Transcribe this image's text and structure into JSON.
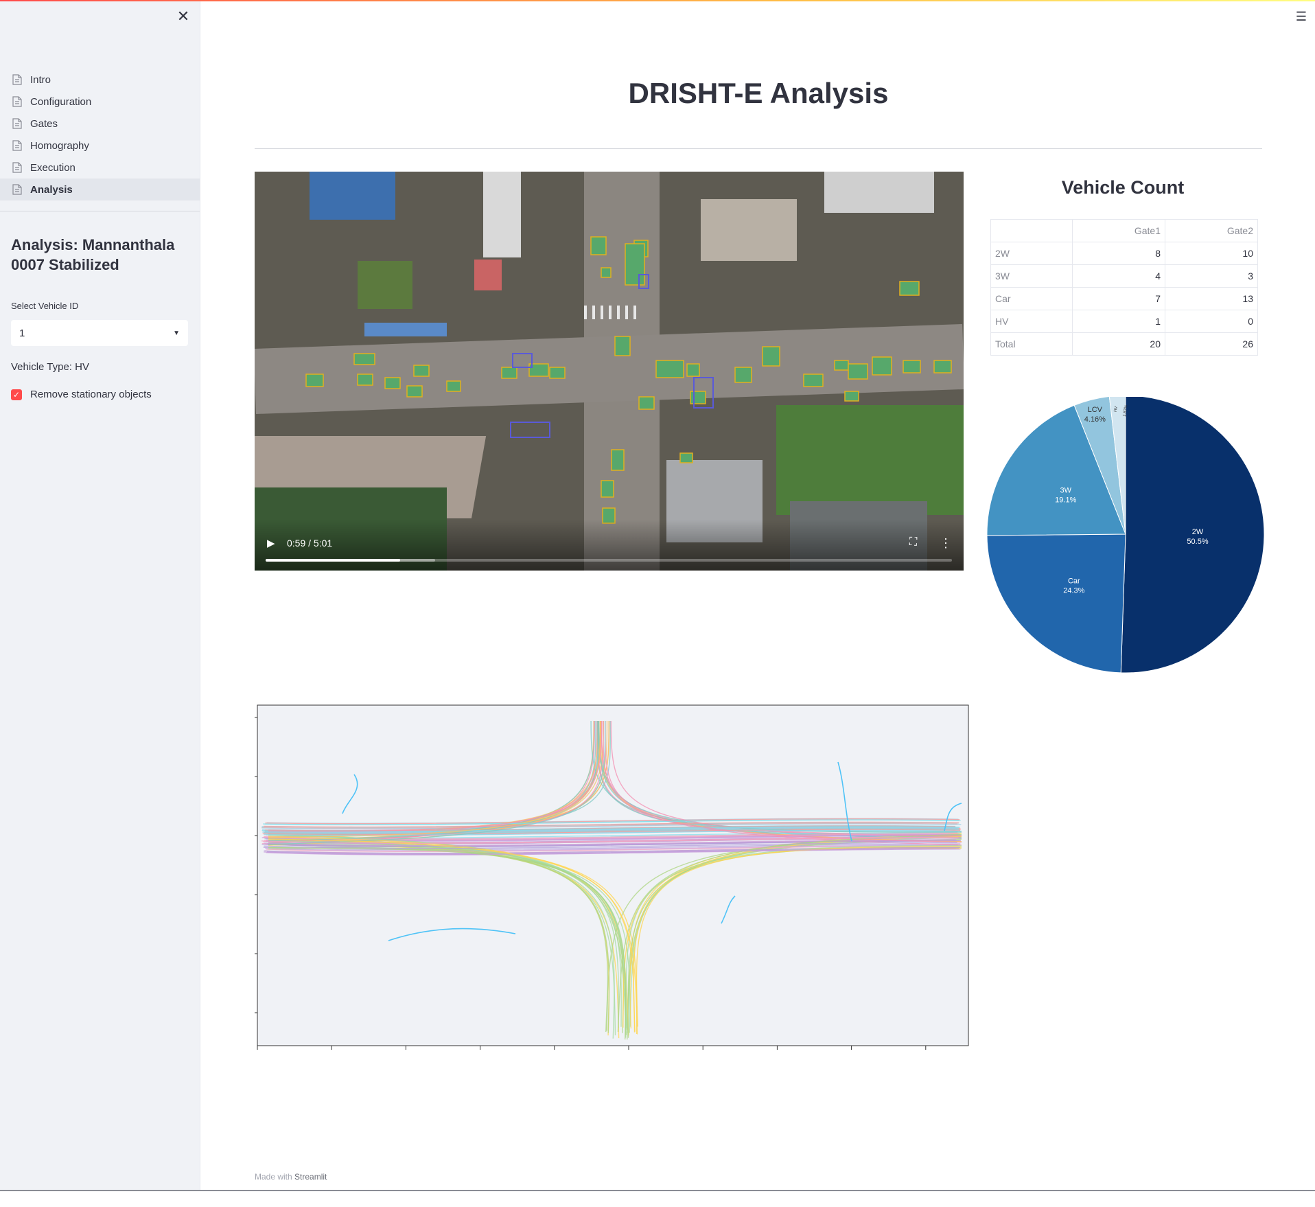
{
  "sidebar": {
    "nav_items": [
      {
        "label": "Intro"
      },
      {
        "label": "Configuration"
      },
      {
        "label": "Gates"
      },
      {
        "label": "Homography"
      },
      {
        "label": "Execution"
      },
      {
        "label": "Analysis"
      }
    ],
    "active_item": "Analysis",
    "analysis_title": "Analysis: Mannanthala 0007 Stabilized",
    "select_label": "Select Vehicle ID",
    "select_value": "1",
    "vehicle_type": "Vehicle Type: HV",
    "checkbox_label": "Remove stationary objects",
    "checkbox_checked": true
  },
  "main": {
    "title": "DRISHT-E Analysis",
    "video": {
      "time_display": "0:59 / 5:01",
      "progress_fraction": 0.196,
      "buffered_fraction": 0.247
    },
    "vehicle_count": {
      "title": "Vehicle Count",
      "columns": [
        "Gate1",
        "Gate2"
      ],
      "rows": [
        {
          "label": "2W",
          "values": [
            "8",
            "10"
          ]
        },
        {
          "label": "3W",
          "values": [
            "4",
            "3"
          ]
        },
        {
          "label": "Car",
          "values": [
            "7",
            "13"
          ]
        },
        {
          "label": "HV",
          "values": [
            "1",
            "0"
          ]
        },
        {
          "label": "Total",
          "values": [
            "20",
            "26"
          ]
        }
      ]
    }
  },
  "chart_data": [
    {
      "type": "pie",
      "title": "",
      "labels": [
        "2W",
        "Car",
        "3W",
        "LCV",
        "HV"
      ],
      "values": [
        50.5,
        24.3,
        19.1,
        4.16,
        1.87
      ],
      "display_labels": [
        "50.5%",
        "24.3%",
        "19.1%",
        "4.16%",
        "1.87%"
      ],
      "colors": [
        "#08306b",
        "#2166ac",
        "#4393c3",
        "#92c5de",
        "#d1e5f0"
      ]
    },
    {
      "type": "line",
      "title": "",
      "description_visible": "vehicle trajectories plotted over intersection",
      "grid": false,
      "background": "#f0f2f6"
    }
  ],
  "colors": {
    "accent": "#ff4b4b",
    "sidebar_bg": "#f0f2f6",
    "text": "#31333f"
  },
  "footer": {
    "prefix": "Made with",
    "link": "Streamlit"
  },
  "icons": {
    "close": "close-icon",
    "menu": "hamburger-menu-icon",
    "nav": "document-icon",
    "play": "play-icon",
    "fullscreen": "fullscreen-icon",
    "more": "more-vertical-icon"
  }
}
